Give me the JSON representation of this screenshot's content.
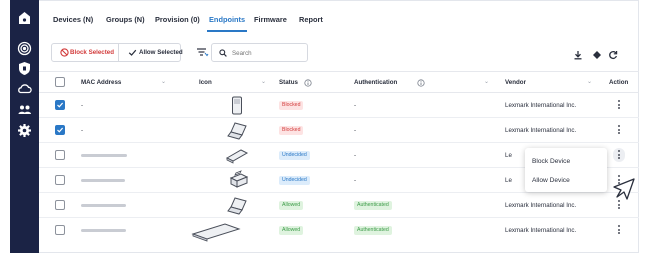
{
  "tabs": [
    {
      "label": "Devices (N)",
      "active": false
    },
    {
      "label": "Groups (N)",
      "active": false
    },
    {
      "label": "Provision (0)",
      "active": false
    },
    {
      "label": "Endpoints",
      "active": true
    },
    {
      "label": "Firmware",
      "active": false
    },
    {
      "label": "Report",
      "active": false
    }
  ],
  "toolbar": {
    "block_label": "Block Selected",
    "allow_label": "Allow Selected",
    "search_placeholder": "Search"
  },
  "columns": {
    "mac": "MAC Address",
    "icon": "Icon",
    "status": "Status",
    "authentication": "Authentication",
    "vendor": "Vendor",
    "action": "Action"
  },
  "rows": [
    {
      "checked": true,
      "mac": "-",
      "device_icon": "printer-tall-icon",
      "status": "Blocked",
      "status_color": "red",
      "auth": "-",
      "vendor": "Lexmark International Inc."
    },
    {
      "checked": true,
      "mac": "-",
      "device_icon": "laptop-icon",
      "status": "Blocked",
      "status_color": "red",
      "auth": "-",
      "vendor": "Lexmark International Inc."
    },
    {
      "checked": false,
      "mac": "",
      "device_icon": "scanner-icon",
      "status": "Undecided",
      "status_color": "blue",
      "auth": "-",
      "vendor": "Le"
    },
    {
      "checked": false,
      "mac": "",
      "device_icon": "printer-icon",
      "status": "Undecided",
      "status_color": "blue",
      "auth": "-",
      "vendor": "Le"
    },
    {
      "checked": false,
      "mac": "",
      "device_icon": "laptop-icon",
      "status": "Allowed",
      "status_color": "green",
      "auth": "Authenticated",
      "vendor": "Lexmark International Inc."
    },
    {
      "checked": false,
      "mac": "",
      "device_icon": "flat-device-icon",
      "status": "Allowed",
      "status_color": "green",
      "auth": "Authenticated",
      "vendor": "Lexmark International Inc."
    }
  ],
  "context_menu": {
    "items": [
      "Block Device",
      "Allow Device"
    ]
  },
  "colors": {
    "sidebar": "#1b2345",
    "accent": "#2a78c6",
    "danger": "#d23b3b"
  }
}
